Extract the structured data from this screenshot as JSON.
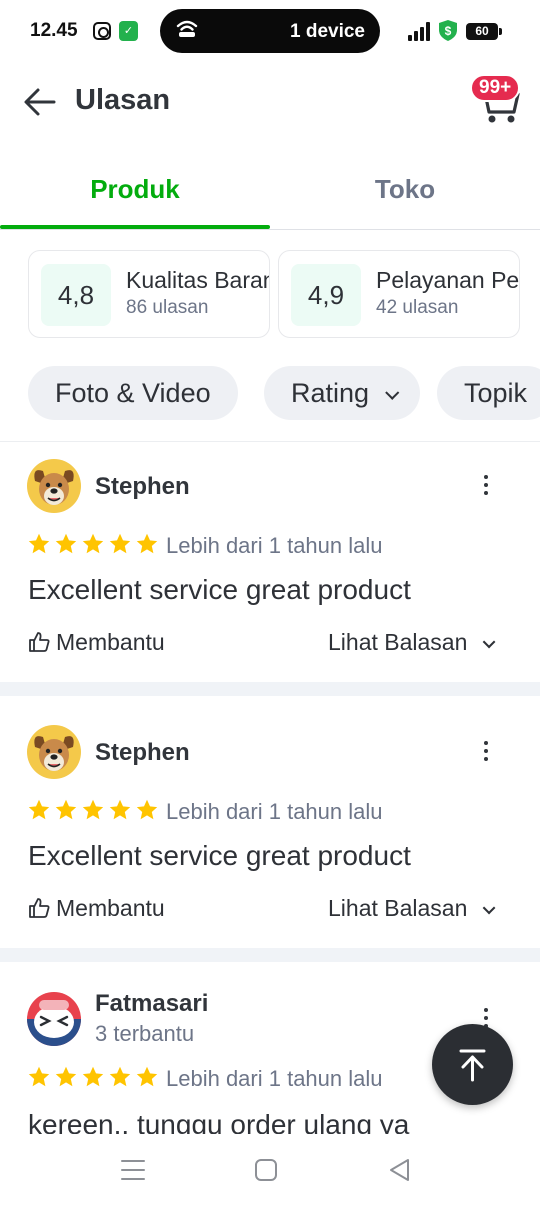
{
  "status_bar": {
    "time": "12.45",
    "device_label": "1 device",
    "battery": "60"
  },
  "header": {
    "title": "Ulasan",
    "cart_badge": "99+"
  },
  "tabs": [
    {
      "label": "Produk",
      "active": true
    },
    {
      "label": "Toko",
      "active": false
    }
  ],
  "summary": [
    {
      "score": "4,8",
      "label": "Kualitas Barang",
      "count": "86 ulasan"
    },
    {
      "score": "4,9",
      "label": "Pelayanan Penjual",
      "count": "42 ulasan"
    }
  ],
  "filters": [
    {
      "label": "Foto & Video"
    },
    {
      "label": "Rating"
    },
    {
      "label": "Topik"
    }
  ],
  "reviews": [
    {
      "name": "Stephen",
      "helped": "",
      "stars": 5,
      "time": "Lebih dari 1 tahun lalu",
      "text": "Excellent service great product",
      "helpful_label": "Membantu",
      "see_reply_label": "Lihat Balasan"
    },
    {
      "name": "Stephen",
      "helped": "",
      "stars": 5,
      "time": "Lebih dari 1 tahun lalu",
      "text": "Excellent service great product",
      "helpful_label": "Membantu",
      "see_reply_label": "Lihat Balasan"
    },
    {
      "name": "Fatmasari",
      "helped": "3 terbantu",
      "stars": 5,
      "time": "Lebih dari 1 tahun lalu",
      "text": "kereen.. tunggu order ulang ya"
    }
  ],
  "colors": {
    "brand_green": "#03ac0e",
    "star_yellow": "#ffc400",
    "badge_red": "#e52b4f",
    "score_bg": "#ecfbf5",
    "fab_bg": "#2b2e33"
  },
  "icons": {
    "back": "arrow-left-icon",
    "cart": "cart-icon",
    "kebab": "more-vertical-icon",
    "helpful": "thumbs-up-icon",
    "fab": "arrow-up-to-line-icon"
  }
}
